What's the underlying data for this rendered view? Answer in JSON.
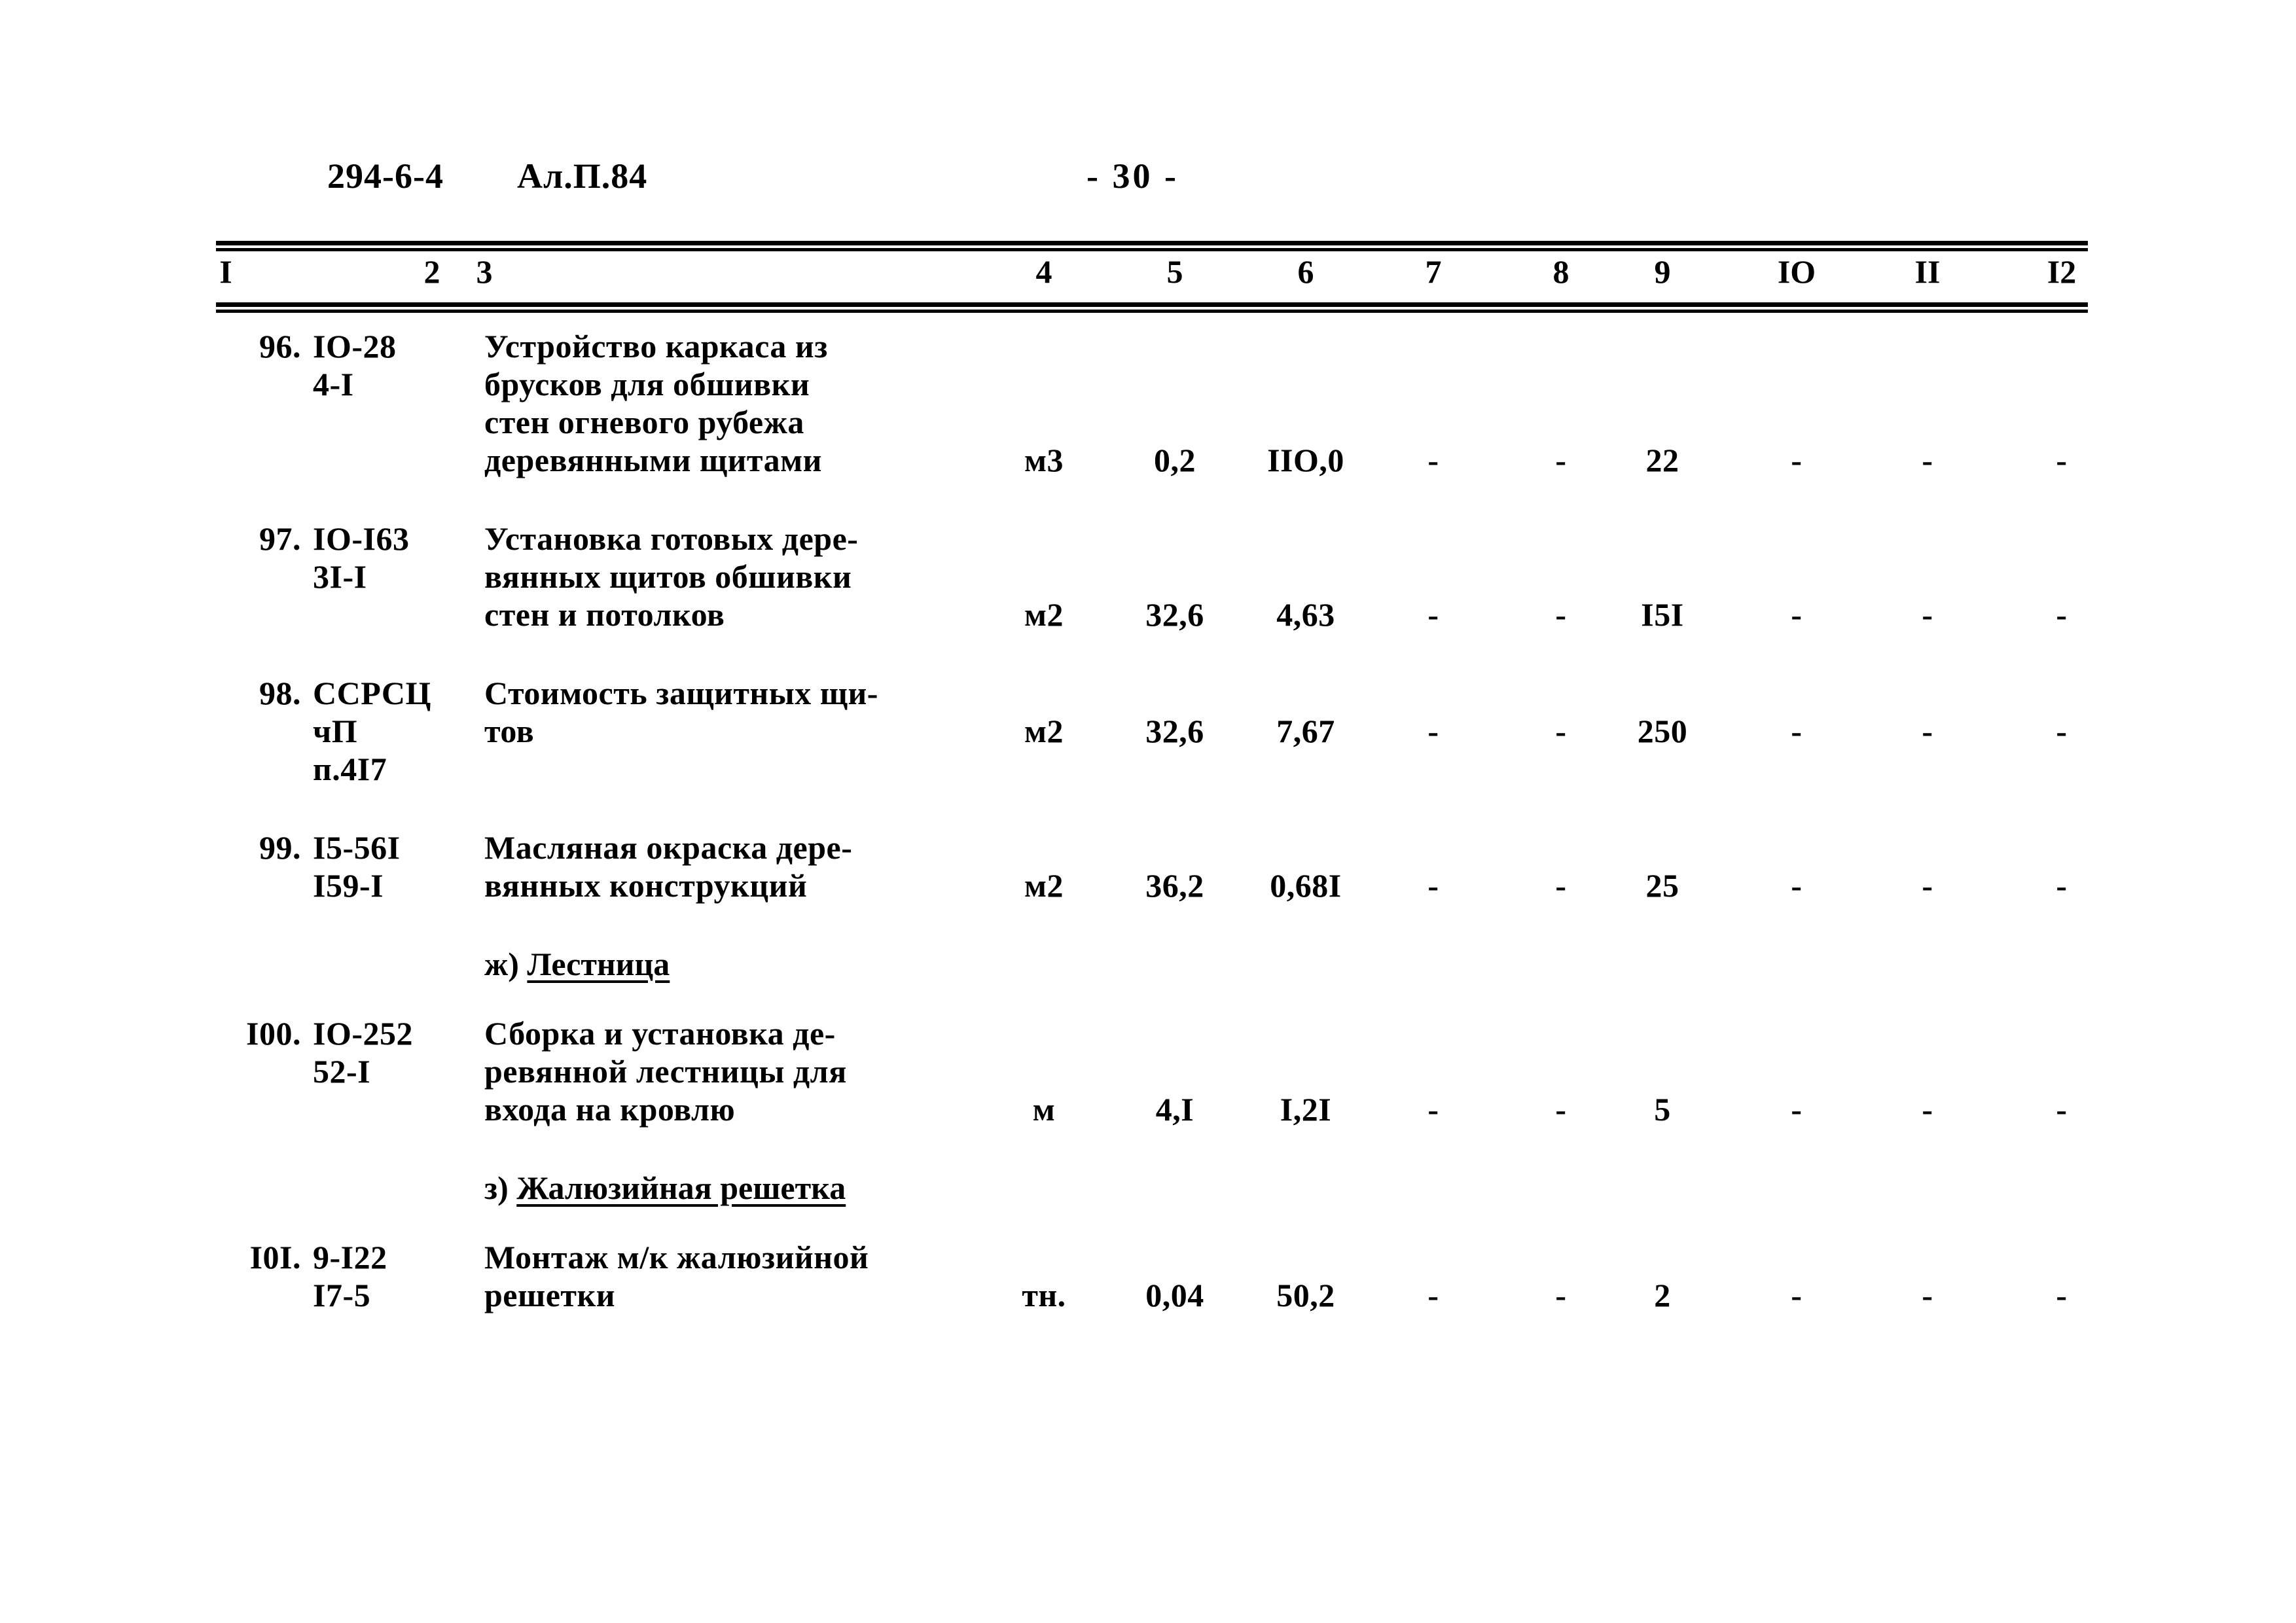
{
  "header": {
    "doc_code": "294-6-4",
    "album_code": "Ал.П.84",
    "page_number": "- 30 -"
  },
  "table": {
    "column_numbers": [
      "I",
      "2",
      "3",
      "4",
      "5",
      "6",
      "7",
      "8",
      "9",
      "IO",
      "II",
      "I2"
    ],
    "rows": [
      {
        "kind": "item",
        "index": "96.",
        "code_lines": [
          "IO-28",
          "4-I"
        ],
        "description_lines": [
          "Устройство каркаса из",
          "брусков для обшивки",
          "стен огневого рубежа",
          "деревянными щитами"
        ],
        "unit": "м3",
        "c5": "0,2",
        "c6": "IIO,0",
        "c7": "-",
        "c8": "-",
        "c9": "22",
        "c10": "-",
        "c11": "-",
        "c12": "-",
        "value_line": 4
      },
      {
        "kind": "item",
        "index": "97.",
        "code_lines": [
          "IO-I63",
          "3I-I"
        ],
        "description_lines": [
          "Установка готовых дере-",
          "вянных щитов обшивки",
          "стен и потолков"
        ],
        "unit": "м2",
        "c5": "32,6",
        "c6": "4,63",
        "c7": "-",
        "c8": "-",
        "c9": "I5I",
        "c10": "-",
        "c11": "-",
        "c12": "-",
        "value_line": 3
      },
      {
        "kind": "item",
        "index": "98.",
        "code_lines": [
          "ССРСЦ",
          "чП",
          "п.4I7"
        ],
        "description_lines": [
          "Стоимость защитных щи-",
          "тов"
        ],
        "unit": "м2",
        "c5": "32,6",
        "c6": "7,67",
        "c7": "-",
        "c8": "-",
        "c9": "250",
        "c10": "-",
        "c11": "-",
        "c12": "-",
        "value_line": 2
      },
      {
        "kind": "item",
        "index": "99.",
        "code_lines": [
          "I5-56I",
          "I59-I"
        ],
        "description_lines": [
          "Масляная окраска дере-",
          "вянных конструкций"
        ],
        "unit": "м2",
        "c5": "36,2",
        "c6": "0,68I",
        "c7": "-",
        "c8": "-",
        "c9": "25",
        "c10": "-",
        "c11": "-",
        "c12": "-",
        "value_line": 2
      },
      {
        "kind": "subheading",
        "marker": "ж)",
        "caption": "Лестница"
      },
      {
        "kind": "item",
        "index": "I00.",
        "code_lines": [
          "IO-252",
          "52-I"
        ],
        "description_lines": [
          "Сборка и установка де-",
          "ревянной лестницы для",
          "входа на кровлю"
        ],
        "unit": "м",
        "c5": "4,I",
        "c6": "I,2I",
        "c7": "-",
        "c8": "-",
        "c9": "5",
        "c10": "-",
        "c11": "-",
        "c12": "-",
        "value_line": 3
      },
      {
        "kind": "subheading",
        "marker": "з)",
        "caption": "Жалюзийная решетка"
      },
      {
        "kind": "item",
        "index": "I0I.",
        "code_lines": [
          "9-I22",
          "I7-5"
        ],
        "description_lines": [
          "Монтаж м/к жалюзийной",
          "решетки"
        ],
        "unit": "тн.",
        "c5": "0,04",
        "c6": "50,2",
        "c7": "-",
        "c8": "-",
        "c9": "2",
        "c10": "-",
        "c11": "-",
        "c12": "-",
        "value_line": 2
      }
    ]
  }
}
